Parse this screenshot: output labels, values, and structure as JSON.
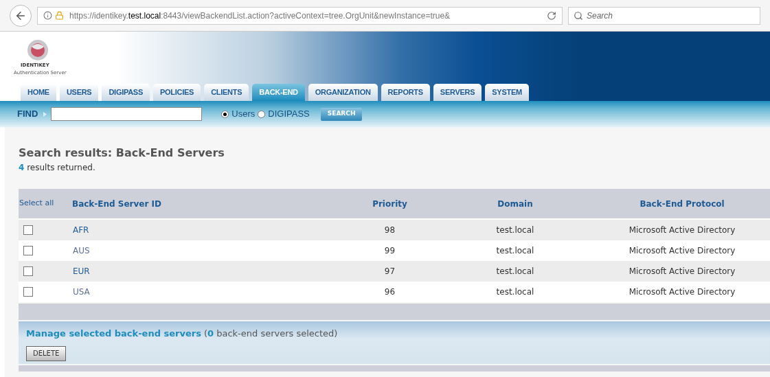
{
  "browser": {
    "url": "https://identikey.**test.local**:8443/viewBackendList.action?activeContext=tree.OrgUnit&newInstance=true&",
    "search_placeholder": "Search"
  },
  "logo": {
    "name": "IDENTIKEY",
    "subtitle": "Authentication Server"
  },
  "tabs": [
    {
      "label": "HOME",
      "selected": false
    },
    {
      "label": "USERS",
      "selected": false
    },
    {
      "label": "DIGIPASS",
      "selected": false
    },
    {
      "label": "POLICIES",
      "selected": false
    },
    {
      "label": "CLIENTS",
      "selected": false
    },
    {
      "label": "BACK-END",
      "selected": true
    },
    {
      "label": "ORGANIZATION",
      "selected": false
    },
    {
      "label": "REPORTS",
      "selected": false
    },
    {
      "label": "SERVERS",
      "selected": false
    },
    {
      "label": "SYSTEM",
      "selected": false
    }
  ],
  "find": {
    "label": "FIND",
    "options": [
      {
        "label": "Users",
        "selected": true
      },
      {
        "label": "DIGIPASS",
        "selected": false
      }
    ],
    "button": "SEARCH"
  },
  "results": {
    "title": "Search results: Back-End Servers",
    "count": "4",
    "count_text": "results returned."
  },
  "table": {
    "select_all": "Select all",
    "columns": [
      "Back-End Server ID",
      "Priority",
      "Domain",
      "Back-End Protocol"
    ],
    "rows": [
      {
        "checked": false,
        "visited": false,
        "cells": [
          "AFR",
          "98",
          "test.local",
          "Microsoft Active Directory"
        ]
      },
      {
        "checked": false,
        "visited": true,
        "cells": [
          "AUS",
          "99",
          "test.local",
          "Microsoft Active Directory"
        ]
      },
      {
        "checked": false,
        "visited": false,
        "cells": [
          "EUR",
          "97",
          "test.local",
          "Microsoft Active Directory"
        ]
      },
      {
        "checked": false,
        "visited": true,
        "cells": [
          "USA",
          "96",
          "test.local",
          "Microsoft Active Directory"
        ]
      }
    ]
  },
  "manage": {
    "link": "Manage selected back-end servers",
    "status": "(**0** back-end servers selected)",
    "button": "DELETE"
  }
}
